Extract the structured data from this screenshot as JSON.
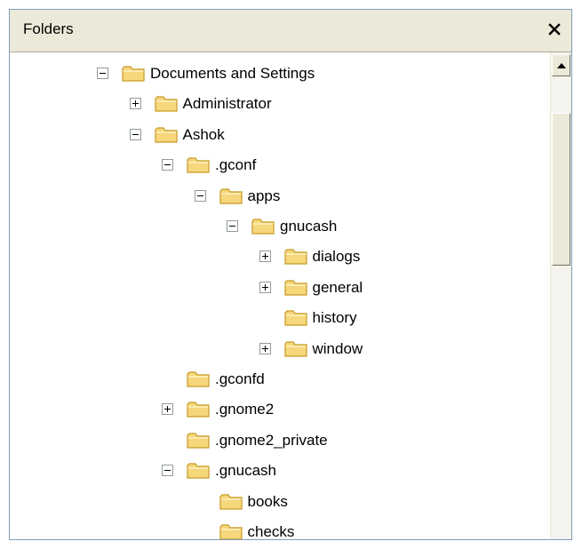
{
  "panel": {
    "title": "Folders",
    "close_label": "✕"
  },
  "tree": [
    {
      "label": "Documents and Settings",
      "depth": 0,
      "expander": "minus"
    },
    {
      "label": "Administrator",
      "depth": 1,
      "expander": "plus"
    },
    {
      "label": "Ashok",
      "depth": 1,
      "expander": "minus"
    },
    {
      "label": ".gconf",
      "depth": 2,
      "expander": "minus"
    },
    {
      "label": "apps",
      "depth": 3,
      "expander": "minus"
    },
    {
      "label": "gnucash",
      "depth": 4,
      "expander": "minus"
    },
    {
      "label": "dialogs",
      "depth": 5,
      "expander": "plus"
    },
    {
      "label": "general",
      "depth": 5,
      "expander": "plus"
    },
    {
      "label": "history",
      "depth": 5,
      "expander": "none"
    },
    {
      "label": "window",
      "depth": 5,
      "expander": "plus"
    },
    {
      "label": ".gconfd",
      "depth": 2,
      "expander": "none"
    },
    {
      "label": ".gnome2",
      "depth": 2,
      "expander": "plus"
    },
    {
      "label": ".gnome2_private",
      "depth": 2,
      "expander": "none"
    },
    {
      "label": ".gnucash",
      "depth": 2,
      "expander": "minus"
    },
    {
      "label": "books",
      "depth": 3,
      "expander": "none"
    },
    {
      "label": "checks",
      "depth": 3,
      "expander": "none"
    }
  ],
  "colors": {
    "folder_fill": "#f6d77b",
    "folder_stroke": "#c79a25",
    "header_bg": "#ece9d8",
    "border": "#7f9db9"
  },
  "icons": {
    "folder": "folder-icon",
    "expand": "plus-box-icon",
    "collapse": "minus-box-icon",
    "close": "close-icon",
    "scroll_up": "arrow-up-icon"
  }
}
